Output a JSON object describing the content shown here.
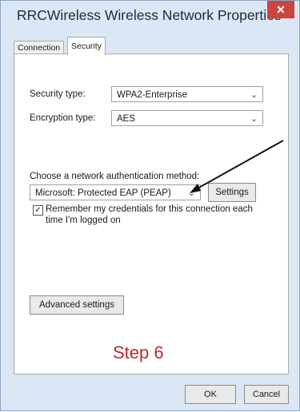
{
  "window": {
    "title": "RRCWireless Wireless Network Properties",
    "close_symbol": "✕"
  },
  "tabs": [
    {
      "label": "Connection"
    },
    {
      "label": "Security"
    }
  ],
  "security": {
    "security_type_label": "Security type:",
    "security_type_value": "WPA2-Enterprise",
    "encryption_type_label": "Encryption type:",
    "encryption_type_value": "AES",
    "auth_method_label": "Choose a network authentication method:",
    "auth_method_value": "Microsoft: Protected EAP (PEAP)",
    "settings_button": "Settings",
    "remember_line1": "Remember my credentials for this connection each",
    "remember_line2": "time I'm logged on",
    "remember_checked": true,
    "advanced_button": "Advanced settings"
  },
  "annotation": {
    "step_text": "Step 6",
    "color": "#c0282f"
  },
  "footer": {
    "ok": "OK",
    "cancel": "Cancel"
  }
}
